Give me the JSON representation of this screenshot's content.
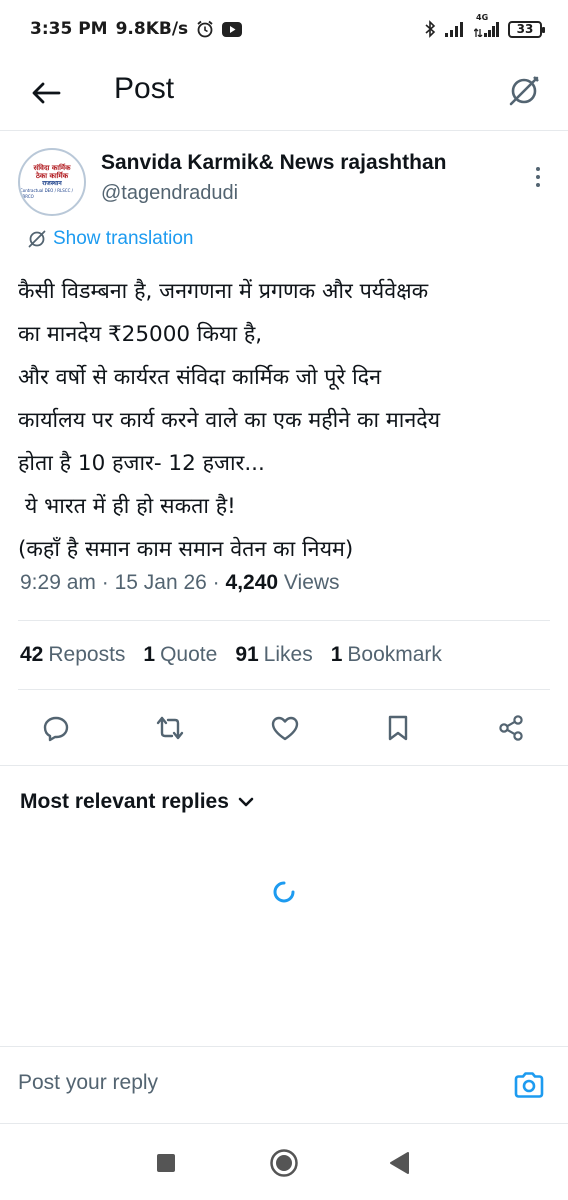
{
  "status_bar": {
    "time": "3:35 PM",
    "speed": "9.8KB/s",
    "network": "4G",
    "battery": "33",
    "icons": [
      "alarm-icon",
      "youtube-icon",
      "bluetooth-icon",
      "signal-icon",
      "signal-4g-icon",
      "battery-icon"
    ]
  },
  "header": {
    "title": "Post",
    "back_icon": "arrow-left-icon",
    "grok_icon": "grok-icon"
  },
  "post": {
    "author_name": "Sanvida Karmik& News rajashthan",
    "author_handle": "@tagendradudi",
    "avatar_text": [
      "संविदा कार्मिक",
      "ठेका कार्मिक",
      "राजस्थान",
      "Contractual DEO / RLSCC / EBRCO"
    ],
    "translate_label": "Show translation",
    "text_lines": [
      "कैसी विडम्बना है, जनगणना में प्रगणक और पर्यवेक्षक",
      "का मानदेय ₹25000 किया है,",
      "और वर्षो से कार्यरत संविदा कार्मिक जो पूरे दिन",
      "कार्यालय पर कार्य करने वाले का एक महीने का मानदेय",
      "होता है 10 हजार- 12 हजार...",
      " ये भारत में ही हो सकता है!",
      "(कहाँ है समान काम समान वेतन का नियम)"
    ],
    "time": "9:29 am",
    "date": "15 Jan 26",
    "views_count": "4,240",
    "views_label": "Views",
    "separator": "·"
  },
  "stats": {
    "reposts_count": "42",
    "reposts_label": "Reposts",
    "quotes_count": "1",
    "quotes_label": "Quote",
    "likes_count": "91",
    "likes_label": "Likes",
    "bookmarks_count": "1",
    "bookmarks_label": "Bookmark"
  },
  "actions": [
    "reply-icon",
    "repost-icon",
    "like-icon",
    "bookmark-icon",
    "share-icon"
  ],
  "replies": {
    "sort_label": "Most relevant replies"
  },
  "reply_bar": {
    "placeholder": "Post your reply"
  },
  "colors": {
    "accent": "#1d9bf0",
    "text": "#0f1419",
    "secondary": "#536471",
    "divider": "#e6e9ec"
  }
}
